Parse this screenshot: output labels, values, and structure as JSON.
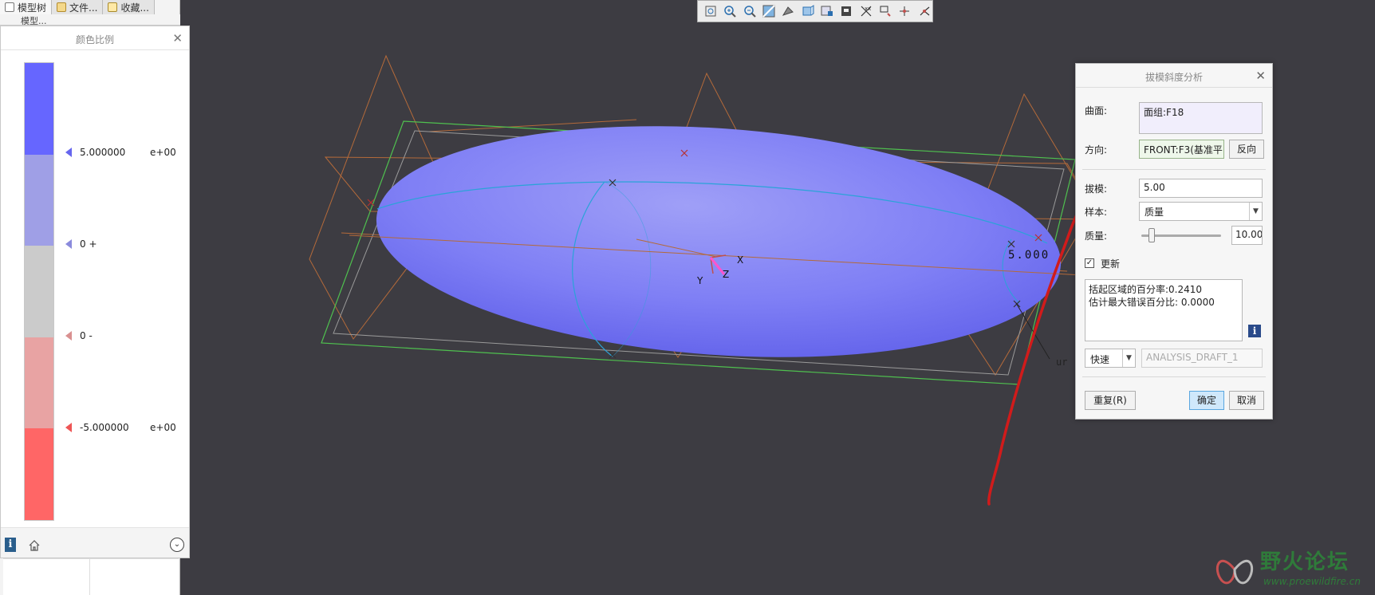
{
  "model_tree": {
    "tabs": [
      {
        "label": "模型树",
        "active": true
      },
      {
        "label": "文件...",
        "active": false
      },
      {
        "label": "收藏...",
        "active": false
      }
    ],
    "sub_label": "模型..."
  },
  "color_scale": {
    "title": "颜色比例",
    "colors": [
      "#6666ff",
      "#9f9fe6",
      "#cbcbcb",
      "#e8a3a3",
      "#ff6666"
    ],
    "ticks": [
      {
        "value": "5.000000",
        "exponent": "e+00",
        "color": "#6666ee"
      },
      {
        "value": "0 +",
        "exponent": "",
        "color": "#8a8adc"
      },
      {
        "value": "0 -",
        "exponent": "",
        "color": "#d99090"
      },
      {
        "value": "-5.000000",
        "exponent": "e+00",
        "color": "#ee5555"
      }
    ]
  },
  "toolbar": {
    "icons": [
      "refit-icon",
      "zoom-in-icon",
      "zoom-out-icon",
      "repaint-icon",
      "display-style-icon",
      "saved-orientations-icon",
      "view-manager-icon",
      "datum-display-icon",
      "annotation-display-icon",
      "spin-center-icon",
      "point-display-icon",
      "csys-display-icon"
    ]
  },
  "viewport": {
    "label_draft_value": "5.000",
    "axis_x": "X",
    "axis_y": "Y",
    "axis_z": "Z",
    "side_text": "ur",
    "accent_part": "#6d6dfa"
  },
  "draft_dialog": {
    "title": "拔模斜度分析",
    "surface_label": "曲面:",
    "surface_value": "面组:F18",
    "direction_label": "方向:",
    "direction_value": "FRONT:F3(基准平",
    "flip_label": "反向",
    "draft_label": "拔模:",
    "draft_value": "5.00",
    "sample_label": "样本:",
    "sample_value": "质量",
    "quality_label": "质量:",
    "quality_value": "10.00",
    "quality_fraction": 0.1,
    "update_label": "更新",
    "update_checked": true,
    "result_line1": "括起区域的百分率:0.2410",
    "result_line2": "估计最大错误百分比: 0.0000",
    "mode_value": "快速",
    "analysis_name": "ANALYSIS_DRAFT_1",
    "repeat_label": "重复(R)",
    "ok_label": "确定",
    "cancel_label": "取消"
  },
  "watermark": {
    "text": "野火论坛",
    "url": "www.proewildfire.cn"
  }
}
